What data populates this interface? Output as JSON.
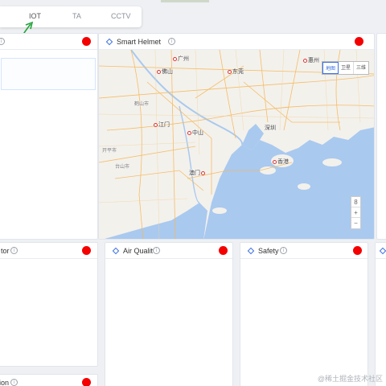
{
  "tabs": [
    {
      "label": "IOT",
      "active": true
    },
    {
      "label": "TA",
      "active": false
    },
    {
      "label": "CCTV",
      "active": false
    }
  ],
  "panels": {
    "left_top": {
      "title": "",
      "status_color": "#f50000"
    },
    "smart_helmet": {
      "title": "Smart Helmet",
      "status_color": "#f50000"
    },
    "left_mid": {
      "title": "tor",
      "status_color": "#f50000"
    },
    "air_quality": {
      "title": "Air Qualit",
      "status_color": "#f50000"
    },
    "safety": {
      "title": "Safety",
      "status_color": "#f50000"
    },
    "left_bottom": {
      "title": "ion",
      "status_color": "#f50000"
    }
  },
  "map": {
    "places": {
      "guangzhou": "广州",
      "huizhou": "惠州",
      "foshan": "佛山",
      "dongguan": "东莞",
      "heshan": "鹤山市",
      "jiangmen": "江门",
      "zhongshan": "中山",
      "shenzhen": "深圳",
      "kaiping": "开平市",
      "taishan": "台山市",
      "macau": "澳门",
      "hongkong": "香港"
    },
    "type_buttons": [
      "地图",
      "卫星",
      "三维"
    ],
    "selected_type": "地图",
    "zoom_level_label": "8",
    "zoom_in": "+",
    "zoom_out": "−"
  },
  "watermark": "@稀土掘金技术社区",
  "colors": {
    "accent": "#3a6fe0",
    "alarm": "#f50000",
    "sea": "#a9c9ef",
    "land": "#f3f1ec",
    "road": "#f5b85a"
  }
}
